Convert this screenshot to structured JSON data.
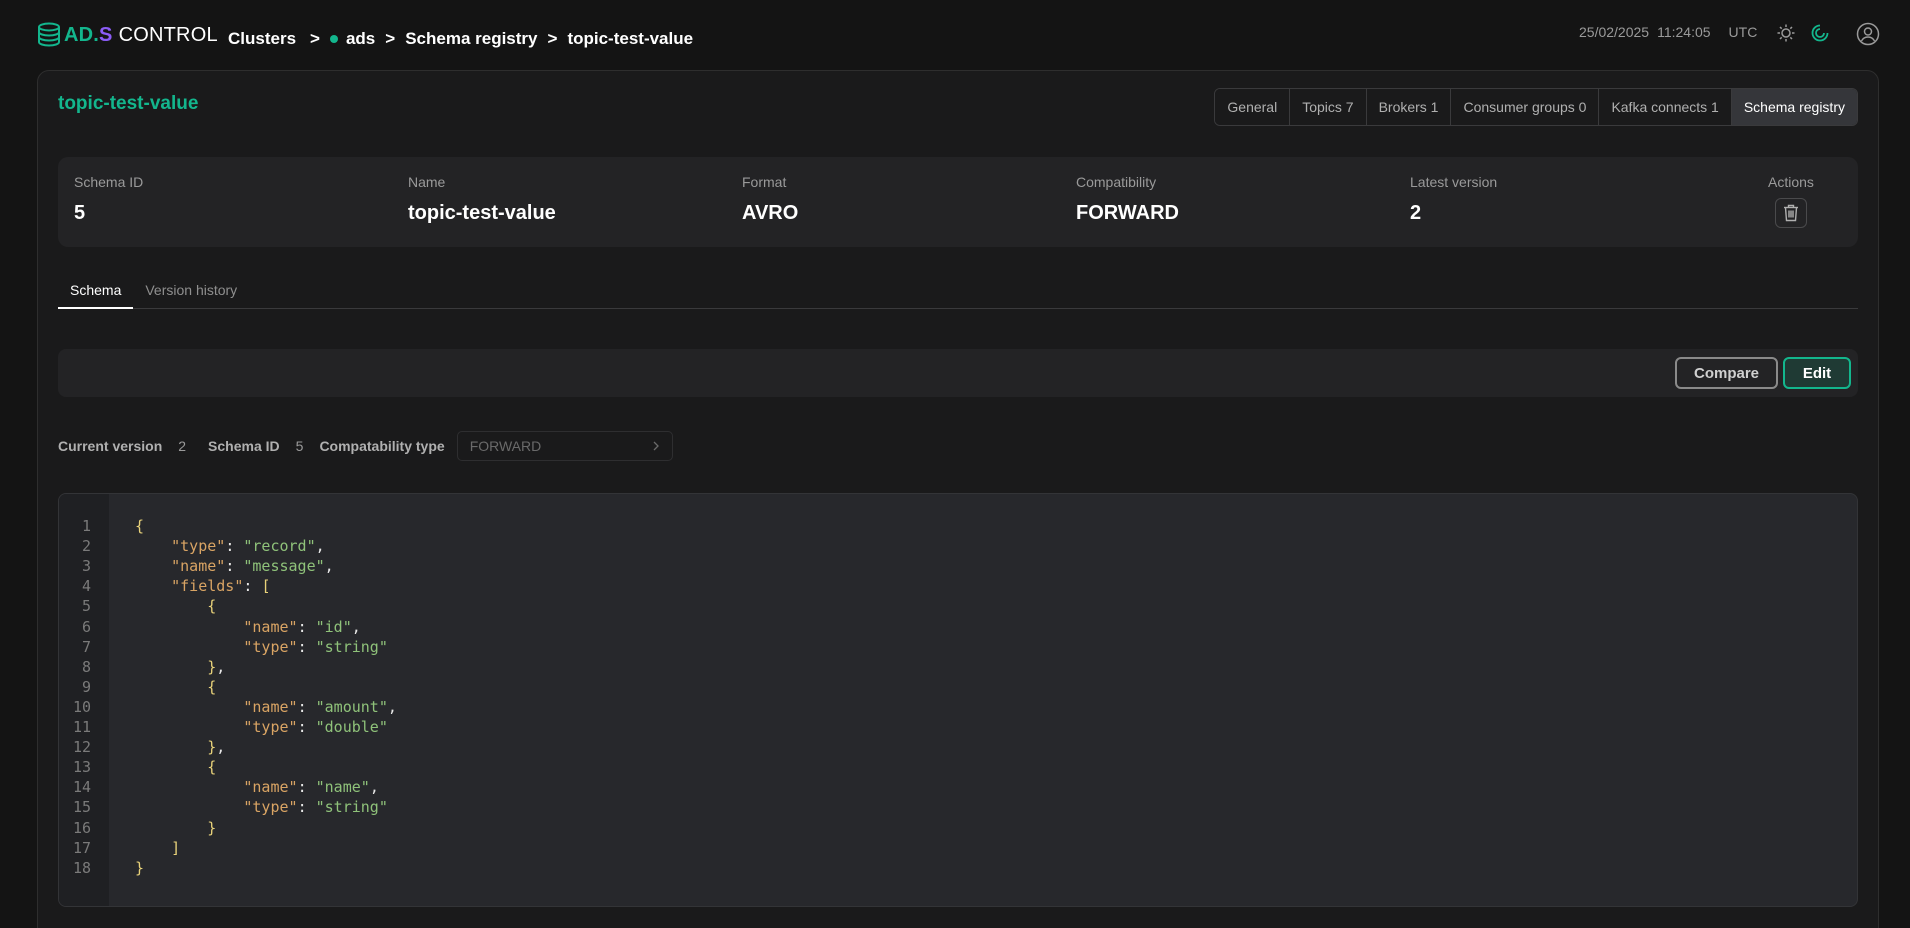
{
  "app": {
    "logo_ad": "AD.",
    "logo_s": "S",
    "logo_control": "CONTROL"
  },
  "breadcrumb": {
    "clusters": "Clusters",
    "cluster": "ads",
    "section": "Schema registry",
    "current": "topic-test-value",
    "separator": ">"
  },
  "header": {
    "date": "25/02/2025",
    "time": "11:24:05",
    "timezone": "UTC"
  },
  "page": {
    "title": "topic-test-value"
  },
  "cluster_tabs": [
    {
      "label": "General",
      "active": false
    },
    {
      "label": "Topics 7",
      "active": false
    },
    {
      "label": "Brokers 1",
      "active": false
    },
    {
      "label": "Consumer groups 0",
      "active": false
    },
    {
      "label": "Kafka connects 1",
      "active": false
    },
    {
      "label": "Schema registry",
      "active": true
    }
  ],
  "info": {
    "schema_id_label": "Schema ID",
    "schema_id": "5",
    "name_label": "Name",
    "name": "topic-test-value",
    "format_label": "Format",
    "format": "AVRO",
    "compatibility_label": "Compatibility",
    "compatibility": "FORWARD",
    "latest_version_label": "Latest version",
    "latest_version": "2",
    "actions_label": "Actions"
  },
  "subtabs": [
    {
      "label": "Schema",
      "active": true
    },
    {
      "label": "Version history",
      "active": false
    }
  ],
  "toolbar": {
    "compare_label": "Compare",
    "edit_label": "Edit"
  },
  "meta": {
    "current_version_label": "Current version",
    "current_version": "2",
    "schema_id_label": "Schema ID",
    "schema_id": "5",
    "compat_type_label": "Compatability type",
    "compat_type_value": "FORWARD"
  },
  "editor": {
    "lines": [
      "{",
      "    \"type\": \"record\",",
      "    \"name\": \"message\",",
      "    \"fields\": [",
      "        {",
      "            \"name\": \"id\",",
      "            \"type\": \"string\"",
      "        },",
      "        {",
      "            \"name\": \"amount\",",
      "            \"type\": \"double\"",
      "        },",
      "        {",
      "            \"name\": \"name\",",
      "            \"type\": \"string\"",
      "        }",
      "    ]",
      "}"
    ]
  },
  "colors": {
    "accent": "#13b68d",
    "logo_s": "#8b5cf6",
    "json_key": "#d9a464",
    "json_string": "#8fc27a"
  },
  "icons": {
    "theme": "sun-icon",
    "loading": "spinner-icon",
    "profile": "user-icon",
    "delete": "trash-icon",
    "select": "chevron-right-icon"
  }
}
